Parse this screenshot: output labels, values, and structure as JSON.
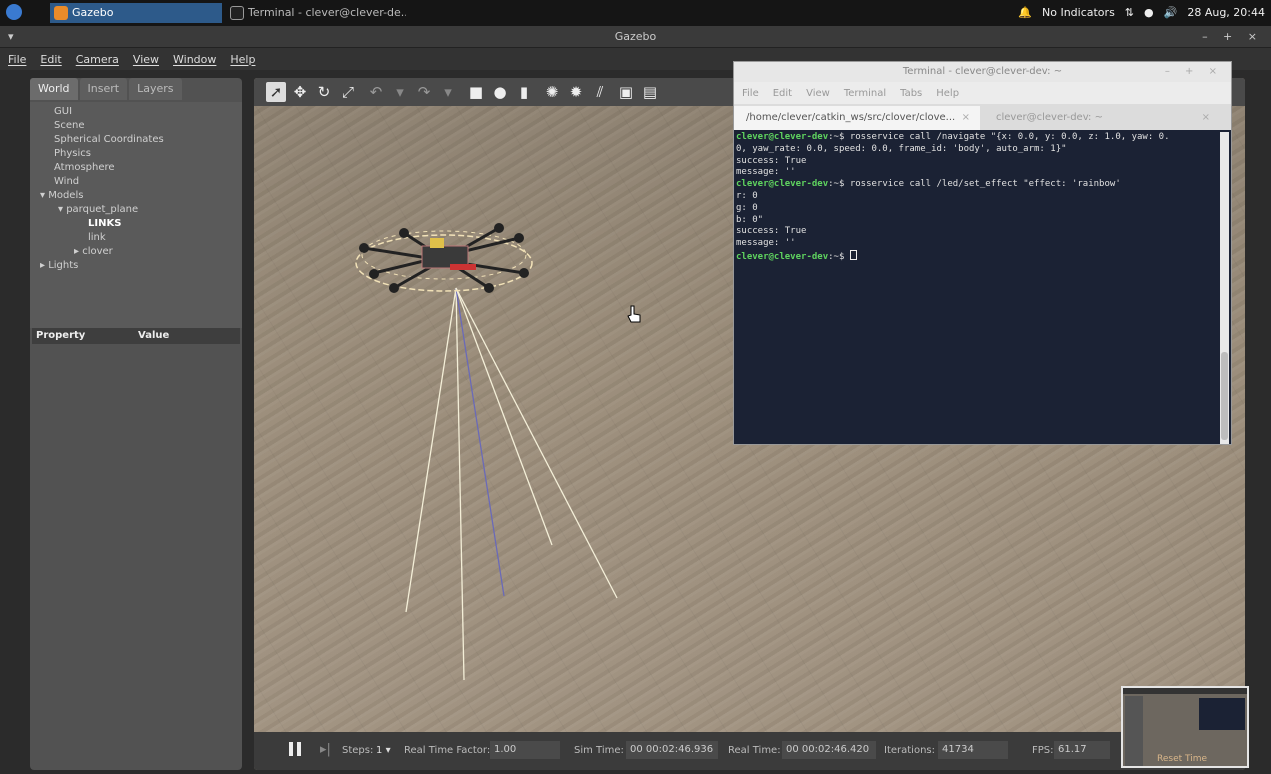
{
  "taskbar": {
    "apps": [
      {
        "label": "Gazebo",
        "icon": "gazebo-icon",
        "active": true
      },
      {
        "label": "Terminal - clever@clever-de...",
        "icon": "terminal-icon",
        "active": false
      }
    ],
    "tray": {
      "indicators": "No Indicators",
      "datetime": "28 Aug, 20:44"
    }
  },
  "window": {
    "title": "Gazebo",
    "controls": "– + ×",
    "menu": [
      "File",
      "Edit",
      "Camera",
      "View",
      "Window",
      "Help"
    ]
  },
  "left_panel": {
    "tabs": [
      "World",
      "Insert",
      "Layers"
    ],
    "tree": {
      "gui": "GUI",
      "scene": "Scene",
      "spherical": "Spherical Coordinates",
      "physics": "Physics",
      "atmosphere": "Atmosphere",
      "wind": "Wind",
      "models": "Models",
      "parquet_plane": "parquet_plane",
      "links": "LINKS",
      "link": "link",
      "clover": "clover",
      "lights": "Lights"
    },
    "property_header": {
      "property": "Property",
      "value": "Value"
    }
  },
  "bottom_bar": {
    "steps_label": "Steps:",
    "steps_value": "1",
    "rtf_label": "Real Time Factor:",
    "rtf_value": "1.00",
    "sim_time_label": "Sim Time:",
    "sim_time_value": "00 00:02:46.936",
    "real_time_label": "Real Time:",
    "real_time_value": "00 00:02:46.420",
    "iterations_label": "Iterations:",
    "iterations_value": "41734",
    "fps_label": "FPS:",
    "fps_value": "61.17",
    "reset_time": "Reset Time"
  },
  "terminal": {
    "title": "Terminal - clever@clever-dev: ~",
    "controls": "– + ×",
    "menu": [
      "File",
      "Edit",
      "View",
      "Terminal",
      "Tabs",
      "Help"
    ],
    "tabs": [
      {
        "label": "/home/clever/catkin_ws/src/clover/clove..."
      },
      {
        "label": "clever@clever-dev: ~"
      }
    ],
    "prompt_user": "clever@clever-dev",
    "prompt_sep": ":~$ ",
    "lines": [
      "rosservice call /navigate \"{x: 0.0, y: 0.0, z: 1.0, yaw: 0.",
      "0, yaw_rate: 0.0, speed: 0.0, frame_id: 'body', auto_arm: 1}\"",
      "success: True",
      "message: ''",
      "rosservice call /led/set_effect \"effect: 'rainbow'",
      "r: 0",
      "g: 0",
      "b: 0\"",
      "success: True",
      "message: ''"
    ]
  },
  "colors": {
    "viewport_floor": "#988a78",
    "terminal_bg": "#1b2234",
    "prompt_green": "#5fd35f",
    "active_task": "#2d5a8a"
  }
}
